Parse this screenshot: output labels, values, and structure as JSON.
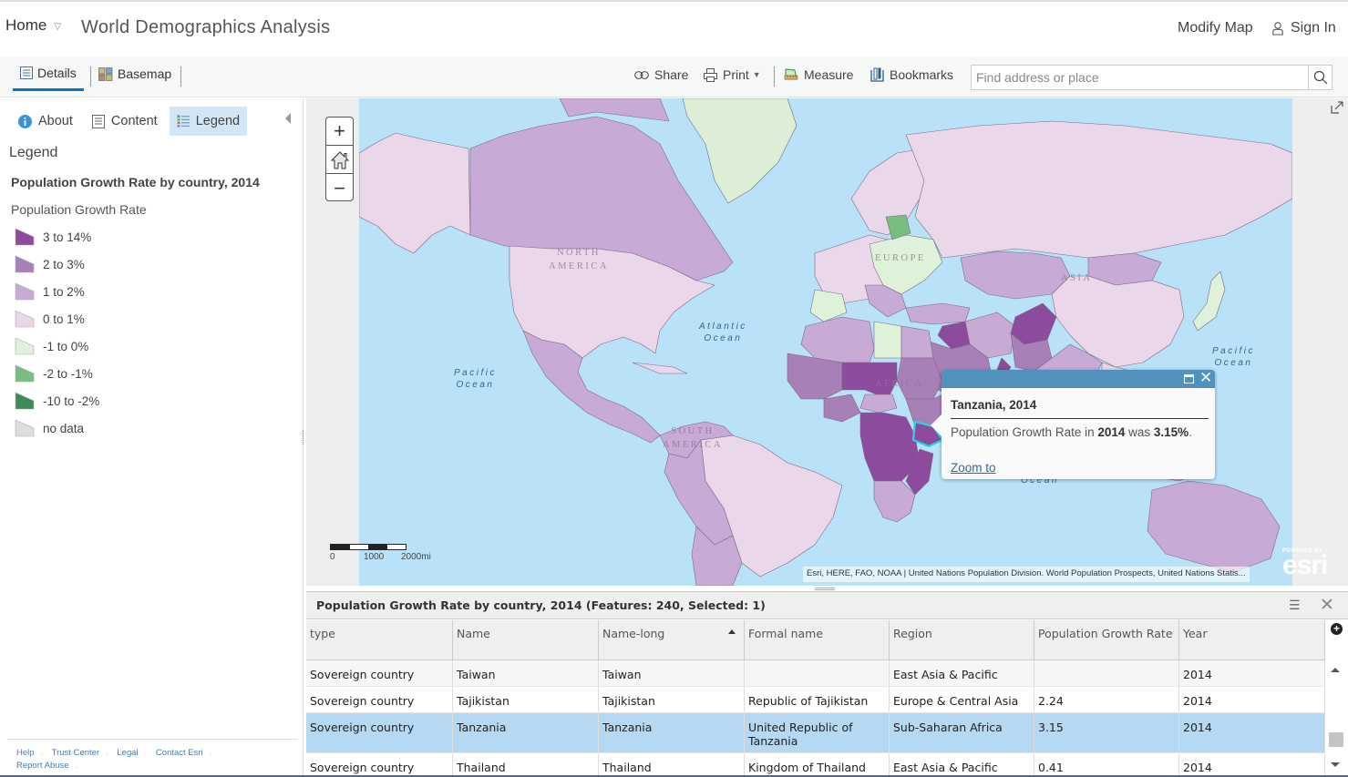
{
  "header": {
    "home_label": "Home",
    "title": "World Demographics Analysis",
    "modify_map": "Modify Map",
    "sign_in": "Sign In"
  },
  "toolbar": {
    "tabs": [
      {
        "label": "Details",
        "icon": "details-icon",
        "active": true
      },
      {
        "label": "Basemap",
        "icon": "basemap-icon",
        "active": false
      }
    ],
    "share_label": "Share",
    "print_label": "Print",
    "measure_label": "Measure",
    "bookmarks_label": "Bookmarks",
    "search_placeholder": "Find address or place",
    "search_value": ""
  },
  "sidebar": {
    "tabs": [
      {
        "label": "About",
        "icon": "info-icon",
        "active": false
      },
      {
        "label": "Content",
        "icon": "content-icon",
        "active": false
      },
      {
        "label": "Legend",
        "icon": "legend-icon",
        "active": true
      }
    ],
    "legend_heading": "Legend",
    "layer_title": "Population Growth Rate by country, 2014",
    "field_title": "Population Growth Rate",
    "legend_items": [
      {
        "label": "3 to 14%",
        "color": "#8c4b9c"
      },
      {
        "label": "2 to 3%",
        "color": "#a780b8"
      },
      {
        "label": "1 to 2%",
        "color": "#c8aad7"
      },
      {
        "label": "0 to 1%",
        "color": "#ead8ea"
      },
      {
        "label": "-1 to 0%",
        "color": "#def2da"
      },
      {
        "label": "-2 to -1%",
        "color": "#78be80"
      },
      {
        "label": "-10 to -2%",
        "color": "#3f8a57"
      },
      {
        "label": "no data",
        "color": "#dddddd"
      }
    ],
    "footer_links": [
      "Help",
      "Trust Center",
      "Legal",
      "Contact Esri",
      "Report Abuse"
    ]
  },
  "map": {
    "zoom_in": "+",
    "zoom_out": "−",
    "scale_labels": [
      "0",
      "1000",
      "2000mi"
    ],
    "attribution": "Esri, HERE, FAO, NOAA | United Nations Population Division. World Population Prospects, United Nations Statis...",
    "esri_powered": "POWERED BY",
    "esri_logo": "esri",
    "labels": {
      "north_america": [
        "NORTH",
        "AMERICA"
      ],
      "south_america": [
        "SOUTH",
        "AMERICA"
      ],
      "europe": "EUROPE",
      "africa": "AFRICA",
      "asia": "ASIA",
      "atlantic": [
        "Atlantic",
        "Ocean"
      ],
      "pacific_w": [
        "Pacific",
        "Ocean"
      ],
      "pacific_e": [
        "Pacific",
        "Ocean"
      ],
      "indian": "Ocean"
    },
    "colors": {
      "ocean": "#b9e2f8",
      "class_3_14": "#8c4b9c",
      "class_2_3": "#a780b8",
      "class_1_2": "#c8aad7",
      "class_0_1": "#ead8ea",
      "class_m1_0": "#def2da",
      "class_m2_m1": "#78be80",
      "no_data": "#dddddd",
      "greenland": "#dcefd6",
      "selection": "#27d5e5"
    }
  },
  "popup": {
    "title": "Tanzania, 2014",
    "body_prefix": "Population Growth Rate in ",
    "body_year": "2014",
    "body_mid": " was ",
    "body_value": "3.15%",
    "body_suffix": ".",
    "zoom_to": "Zoom to"
  },
  "table": {
    "title": "Population Growth Rate by country, 2014 (Features: 240, Selected: 1)",
    "columns": [
      "type",
      "Name",
      "Name-long",
      "Formal name",
      "Region",
      "Population Growth Rate",
      "Year"
    ],
    "sorted_column": "Name-long",
    "rows": [
      {
        "type": "Sovereign country",
        "name": "Taiwan",
        "name_long": "Taiwan",
        "formal": "",
        "region": "East Asia & Pacific",
        "rate": "",
        "year": "2014",
        "selected": false
      },
      {
        "type": "Sovereign country",
        "name": "Tajikistan",
        "name_long": "Tajikistan",
        "formal": "Republic of Tajikistan",
        "region": "Europe & Central Asia",
        "rate": "2.24",
        "year": "2014",
        "selected": false
      },
      {
        "type": "Sovereign country",
        "name": "Tanzania",
        "name_long": "Tanzania",
        "formal": "United Republic of Tanzania",
        "region": "Sub-Saharan Africa",
        "rate": "3.15",
        "year": "2014",
        "selected": true
      },
      {
        "type": "Sovereign country",
        "name": "Thailand",
        "name_long": "Thailand",
        "formal": "Kingdom of Thailand",
        "region": "East Asia & Pacific",
        "rate": "0.41",
        "year": "2014",
        "selected": false
      }
    ]
  }
}
